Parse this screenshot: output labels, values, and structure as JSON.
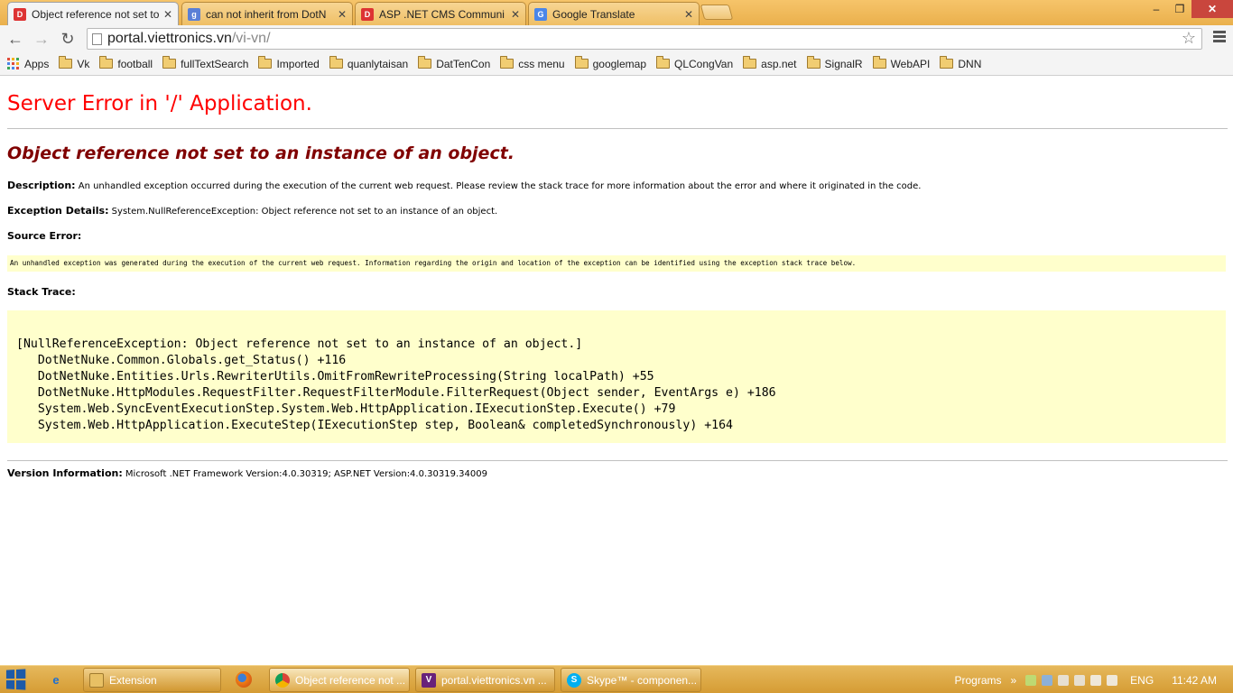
{
  "browser": {
    "tabs": [
      {
        "title": "Object reference not set to",
        "active": true,
        "favicon": "dnn-icon"
      },
      {
        "title": "can not inherit from DotN",
        "active": false,
        "favicon": "google-icon"
      },
      {
        "title": "ASP .NET CMS Communi",
        "active": false,
        "favicon": "dnn-icon"
      },
      {
        "title": "Google Translate",
        "active": false,
        "favicon": "translate-icon"
      }
    ],
    "url_host": "portal.viettronics.vn",
    "url_path": "/vi-vn/"
  },
  "bookmarks": [
    {
      "label": "Apps",
      "type": "apps"
    },
    {
      "label": "Vk",
      "type": "folder"
    },
    {
      "label": "football",
      "type": "folder"
    },
    {
      "label": "fullTextSearch",
      "type": "folder"
    },
    {
      "label": "Imported",
      "type": "folder"
    },
    {
      "label": "quanlytaisan",
      "type": "folder"
    },
    {
      "label": "DatTenCon",
      "type": "folder"
    },
    {
      "label": "css menu",
      "type": "folder"
    },
    {
      "label": "googlemap",
      "type": "folder"
    },
    {
      "label": "QLCongVan",
      "type": "folder"
    },
    {
      "label": "asp.net",
      "type": "folder"
    },
    {
      "label": "SignalR",
      "type": "folder"
    },
    {
      "label": "WebAPI",
      "type": "folder"
    },
    {
      "label": "DNN",
      "type": "folder"
    }
  ],
  "error_page": {
    "title": "Server Error in '/' Application.",
    "message": "Object reference not set to an instance of an object.",
    "description_label": "Description:",
    "description": "An unhandled exception occurred during the execution of the current web request. Please review the stack trace for more information about the error and where it originated in the code.",
    "exception_label": "Exception Details:",
    "exception": "System.NullReferenceException: Object reference not set to an instance of an object.",
    "source_error_label": "Source Error:",
    "source_error": "An unhandled exception was generated during the execution of the current web request. Information regarding the origin and location of the exception can be identified using the exception stack trace below.",
    "stack_trace_label": "Stack Trace:",
    "stack_trace": [
      "[NullReferenceException: Object reference not set to an instance of an object.]",
      "   DotNetNuke.Common.Globals.get_Status() +116",
      "   DotNetNuke.Entities.Urls.RewriterUtils.OmitFromRewriteProcessing(String localPath) +55",
      "   DotNetNuke.HttpModules.RequestFilter.RequestFilterModule.FilterRequest(Object sender, EventArgs e) +186",
      "   System.Web.SyncEventExecutionStep.System.Web.HttpApplication.IExecutionStep.Execute() +79",
      "   System.Web.HttpApplication.ExecuteStep(IExecutionStep step, Boolean& completedSynchronously) +164"
    ],
    "version_label": "Version Information:",
    "version": "Microsoft .NET Framework Version:4.0.30319; ASP.NET Version:4.0.30319.34009"
  },
  "taskbar": {
    "items": [
      {
        "label": "Extension",
        "icon": "folder-icon",
        "active": false
      },
      {
        "label": "Object reference not ...",
        "icon": "chrome-icon",
        "active": true
      },
      {
        "label": "portal.viettronics.vn ...",
        "icon": "visual-studio-icon",
        "active": false
      },
      {
        "label": "Skype™ - componen...",
        "icon": "skype-icon",
        "active": false
      }
    ],
    "programs_label": "Programs",
    "language": "ENG",
    "clock": "11:42 AM"
  }
}
